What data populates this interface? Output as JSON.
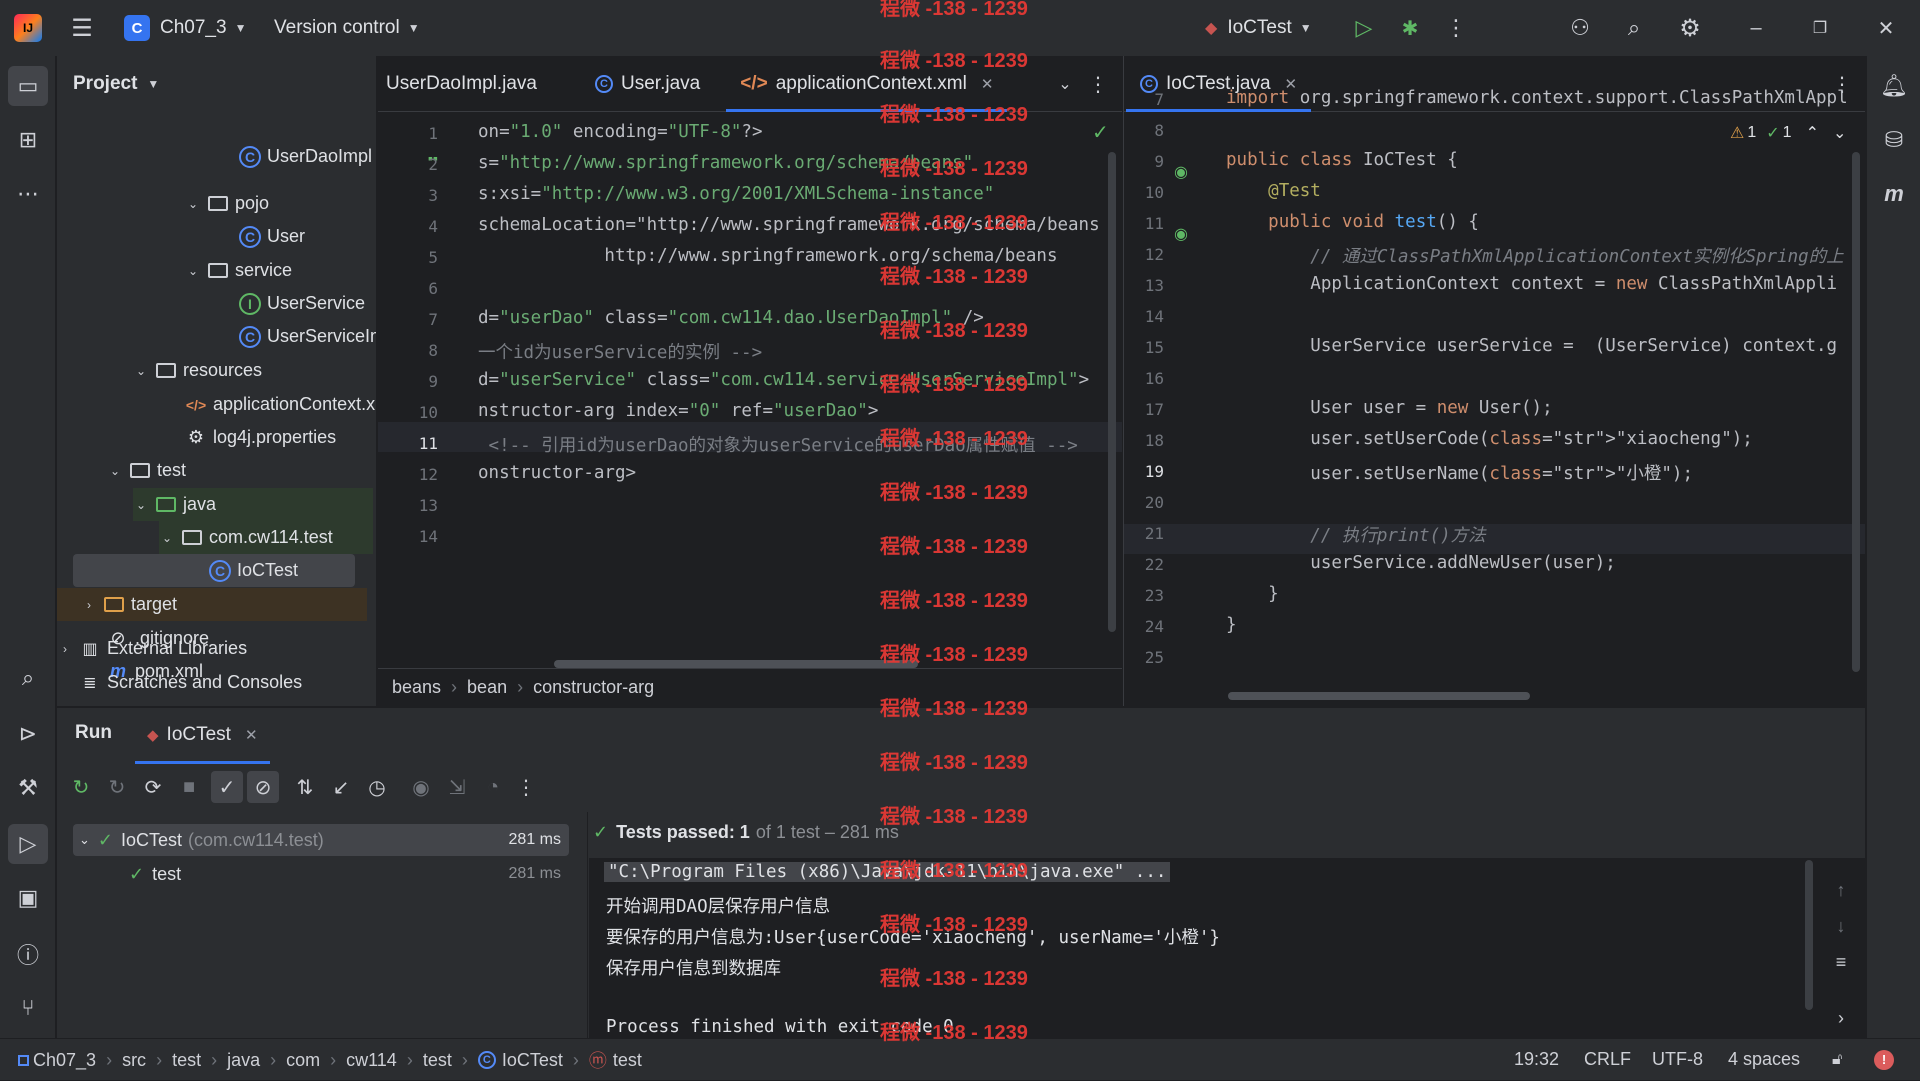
{
  "titlebar": {
    "project_letter": "C",
    "project_name": "Ch07_3",
    "vcs": "Version control",
    "run_config": "IoCTest"
  },
  "project_panel": {
    "title": "Project",
    "items": [
      {
        "label": "UserDaoImpl",
        "icon": "class-icon"
      },
      {
        "label": "pojo",
        "icon": "folder-icon"
      },
      {
        "label": "User",
        "icon": "class-icon"
      },
      {
        "label": "service",
        "icon": "folder-icon"
      },
      {
        "label": "UserService",
        "icon": "interface-icon"
      },
      {
        "label": "UserServiceImpl",
        "icon": "class-icon"
      },
      {
        "label": "resources",
        "icon": "folder-icon"
      },
      {
        "label": "applicationContext.xml",
        "icon": "xml-icon"
      },
      {
        "label": "log4j.properties",
        "icon": "gear-icon"
      },
      {
        "label": "test",
        "icon": "folder-icon"
      },
      {
        "label": "java",
        "icon": "folder-icon"
      },
      {
        "label": "com.cw114.test",
        "icon": "package-icon"
      },
      {
        "label": "IoCTest",
        "icon": "class-icon"
      },
      {
        "label": "target",
        "icon": "folder-icon"
      },
      {
        "label": ".gitignore",
        "icon": "ignore-icon"
      },
      {
        "label": "pom.xml",
        "icon": "maven-icon"
      },
      {
        "label": "External Libraries",
        "icon": "library-icon"
      },
      {
        "label": "Scratches and Consoles",
        "icon": "scratch-icon"
      }
    ]
  },
  "editor1": {
    "tabs": [
      "UserDaoImpl.java",
      "User.java",
      "applicationContext.xml"
    ],
    "lines": [
      "on=\"1.0\" encoding=\"UTF-8\"?>",
      "s=\"http://www.springframework.org/schema/beans\"",
      "s:xsi=\"http://www.w3.org/2001/XMLSchema-instance\"",
      "schemaLocation=\"http://www.springframework.org/schema/beans",
      "            http://www.springframework.org/schema/beans",
      "",
      "d=\"userDao\" class=\"com.cw114.dao.UserDaoImpl\" />",
      "一个id为userService的实例 -->",
      "d=\"userService\" class=\"com.cw114.service.UserServiceImpl\">",
      "nstructor-arg index=\"0\" ref=\"userDao\">",
      " <!-- 引用id为userDao的对象为userService的userDao属性赋值 -->",
      "onstructor-arg>",
      "",
      ""
    ],
    "breadcrumb": [
      "beans",
      "bean",
      "constructor-arg"
    ]
  },
  "editor2": {
    "tab": "IoCTest.java",
    "warnings": "1",
    "checks": "1",
    "lines": [
      {
        "n": "7",
        "text": "import org.springframework.context.support.ClassPathXmlAppl"
      },
      {
        "n": "8",
        "text": ""
      },
      {
        "n": "9",
        "text": "public class IoCTest {"
      },
      {
        "n": "10",
        "text": "    @Test"
      },
      {
        "n": "11",
        "text": "    public void test() {"
      },
      {
        "n": "12",
        "text": "        // 通过ClassPathXmlApplicationContext实例化Spring的上"
      },
      {
        "n": "13",
        "text": "        ApplicationContext context = new ClassPathXmlAppli"
      },
      {
        "n": "14",
        "text": ""
      },
      {
        "n": "15",
        "text": "        UserService userService =  (UserService) context.g"
      },
      {
        "n": "16",
        "text": ""
      },
      {
        "n": "17",
        "text": "        User user = new User();"
      },
      {
        "n": "18",
        "text": "        user.setUserCode(\"xiaocheng\");"
      },
      {
        "n": "19",
        "text": "        user.setUserName(\"小橙\");"
      },
      {
        "n": "20",
        "text": ""
      },
      {
        "n": "21",
        "text": "        // 执行print()方法"
      },
      {
        "n": "22",
        "text": "        userService.addNewUser(user);"
      },
      {
        "n": "23",
        "text": "    }"
      },
      {
        "n": "24",
        "text": "}"
      },
      {
        "n": "25",
        "text": ""
      }
    ]
  },
  "run_panel": {
    "title": "Run",
    "tab": "IoCTest",
    "tree": [
      {
        "label": "IoCTest",
        "sub": "(com.cw114.test)",
        "time": "281 ms"
      },
      {
        "label": "test",
        "sub": "",
        "time": "281 ms"
      }
    ],
    "summary_bold": "Tests passed: 1",
    "summary_rest": "of 1 test – 281 ms",
    "console": [
      "\"C:\\Program Files (x86)\\Java\\jdk-11\\bin\\java.exe\" ...",
      "开始调用DAO层保存用户信息",
      "要保存的用户信息为:User{userCode='xiaocheng', userName='小橙'}",
      "保存用户信息到数据库",
      "",
      "Process finished with exit code 0"
    ]
  },
  "statusbar": {
    "path": [
      "Ch07_3",
      "src",
      "test",
      "java",
      "com",
      "cw114",
      "test",
      "IoCTest",
      "test"
    ],
    "position": "19:32",
    "line_sep": "CRLF",
    "encoding": "UTF-8",
    "indent": "4 spaces"
  },
  "watermark": "程微 -138 - 1239"
}
